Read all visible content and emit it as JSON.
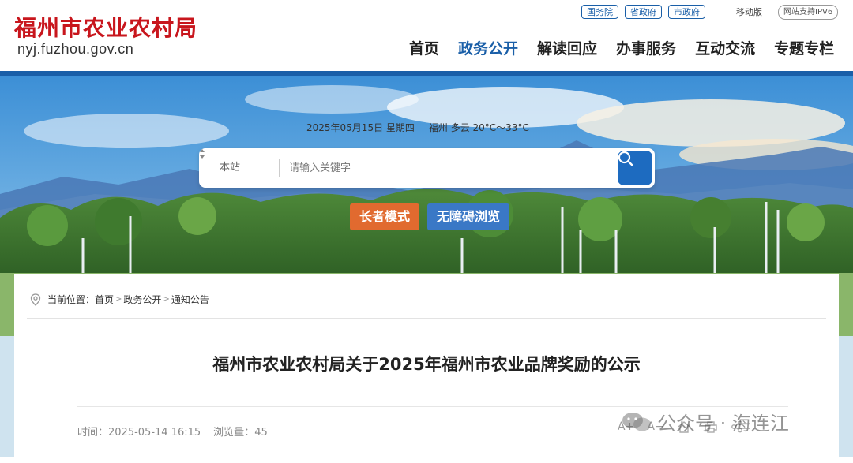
{
  "header": {
    "site_title": "福州市农业农村局",
    "domain": "nyj.fuzhou.gov.cn",
    "top_links": [
      "国务院",
      "省政府",
      "市政府"
    ],
    "mobile_label": "移动版",
    "ipv6_label": "网站支持IPV6",
    "nav": [
      "首页",
      "政务公开",
      "解读回应",
      "办事服务",
      "互动交流",
      "专题专栏"
    ],
    "active_nav": "政务公开",
    "brand_color": "#1a5fa8",
    "title_color": "#c8161d"
  },
  "banner": {
    "date": "2025年05月15日 星期四",
    "weather": "福州 多云 20°C～33°C",
    "search": {
      "scope": "本站",
      "placeholder": "请输入关键字"
    },
    "elder_mode_label": "长者模式",
    "accessible_label": "无障碍浏览"
  },
  "content": {
    "breadcrumb_prefix": "当前位置：",
    "breadcrumb": [
      "首页",
      "政务公开",
      "通知公告"
    ],
    "article_title": "福州市农业农村局关于2025年福州市农业品牌奖励的公示",
    "time_label": "时间：",
    "time_value": "2025-05-14 16:15",
    "views_label": "浏览量：",
    "views_value": "45",
    "font_increase": "A+",
    "font_decrease": "A−",
    "watermark": "公众号 · 海连江"
  }
}
